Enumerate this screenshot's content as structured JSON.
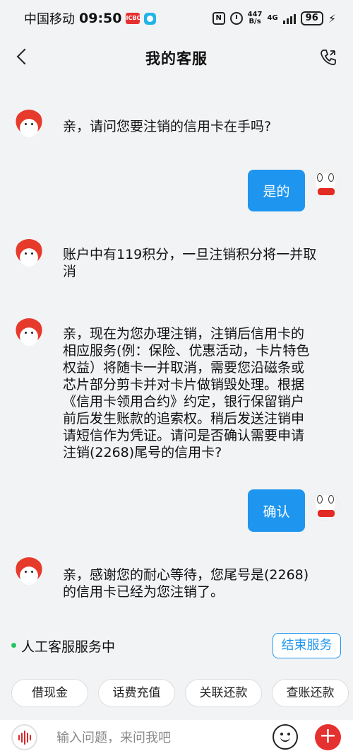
{
  "status_bar": {
    "carrier": "中国移动",
    "time": "09:50",
    "app_badge": "ICBC",
    "net_speed_value": "447",
    "net_speed_unit": "B/s",
    "network": "4G",
    "battery": "96"
  },
  "nav": {
    "title": "我的客服"
  },
  "messages": [
    {
      "side": "left",
      "text": "亲，请问您要注销的信用卡在手吗?"
    },
    {
      "side": "right",
      "text": "是的"
    },
    {
      "side": "left",
      "text": "账户中有119积分，一旦注销积分将一并取消"
    },
    {
      "side": "left",
      "text": "亲，现在为您办理注销，注销后信用卡的相应服务(例：保险、优惠活动，卡片特色权益）将随卡一并取消，需要您沿磁条或芯片部分剪卡并对卡片做销毁处理。根据《信用卡领用合约》约定，银行保留销户前后发生账款的追索权。稍后发送注销申请短信作为凭证。请问是否确认需要申请注销(2268)尾号的信用卡?"
    },
    {
      "side": "right",
      "text": "确认"
    },
    {
      "side": "left",
      "text": "亲，感谢您的耐心等待，您尾号是(2268)的信用卡已经为您注销了。"
    }
  ],
  "service": {
    "status_text": "人工客服服务中",
    "end_button": "结束服务",
    "status_color": "#22c55e"
  },
  "quick_actions": [
    "借现金",
    "话费充值",
    "关联还款",
    "查账还款"
  ],
  "input": {
    "placeholder": "输入问题，来问我吧"
  },
  "colors": {
    "accent": "#1e96f0",
    "brand_red": "#e5312f"
  }
}
